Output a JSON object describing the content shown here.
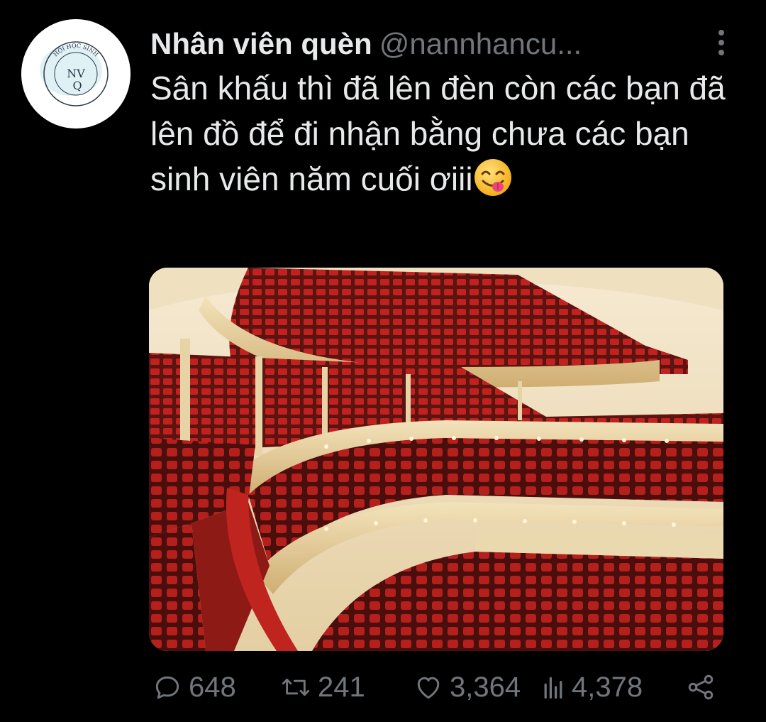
{
  "author": {
    "display_name": "Nhân viên quèn",
    "handle": "@nannhancu...",
    "avatar": {
      "arc_text": "HỘI HỌC SINH",
      "monogram_top": "NV",
      "monogram_bottom": "Q"
    }
  },
  "tweet": {
    "text": "Sân khấu thì đã lên đèn còn các bạn đã lên đồ để đi nhận bằng chưa các bạn sinh viên năm cuối ơiii",
    "emoji": "face-savoring-food"
  },
  "media": {
    "description_icon": "concert-hall-photo"
  },
  "actions": {
    "replies": "648",
    "retweets": "241",
    "likes": "3,364",
    "views": "4,378"
  },
  "icons": {
    "reply": "reply-icon",
    "retweet": "retweet-icon",
    "like": "heart-icon",
    "views": "views-icon",
    "share": "share-icon",
    "more": "more-vertical-icon"
  },
  "colors": {
    "background": "#000000",
    "text_primary": "#e7e9ea",
    "text_secondary": "#71767b",
    "seat_red": "#b3201e",
    "balcony_cream": "#e9d6a8"
  }
}
